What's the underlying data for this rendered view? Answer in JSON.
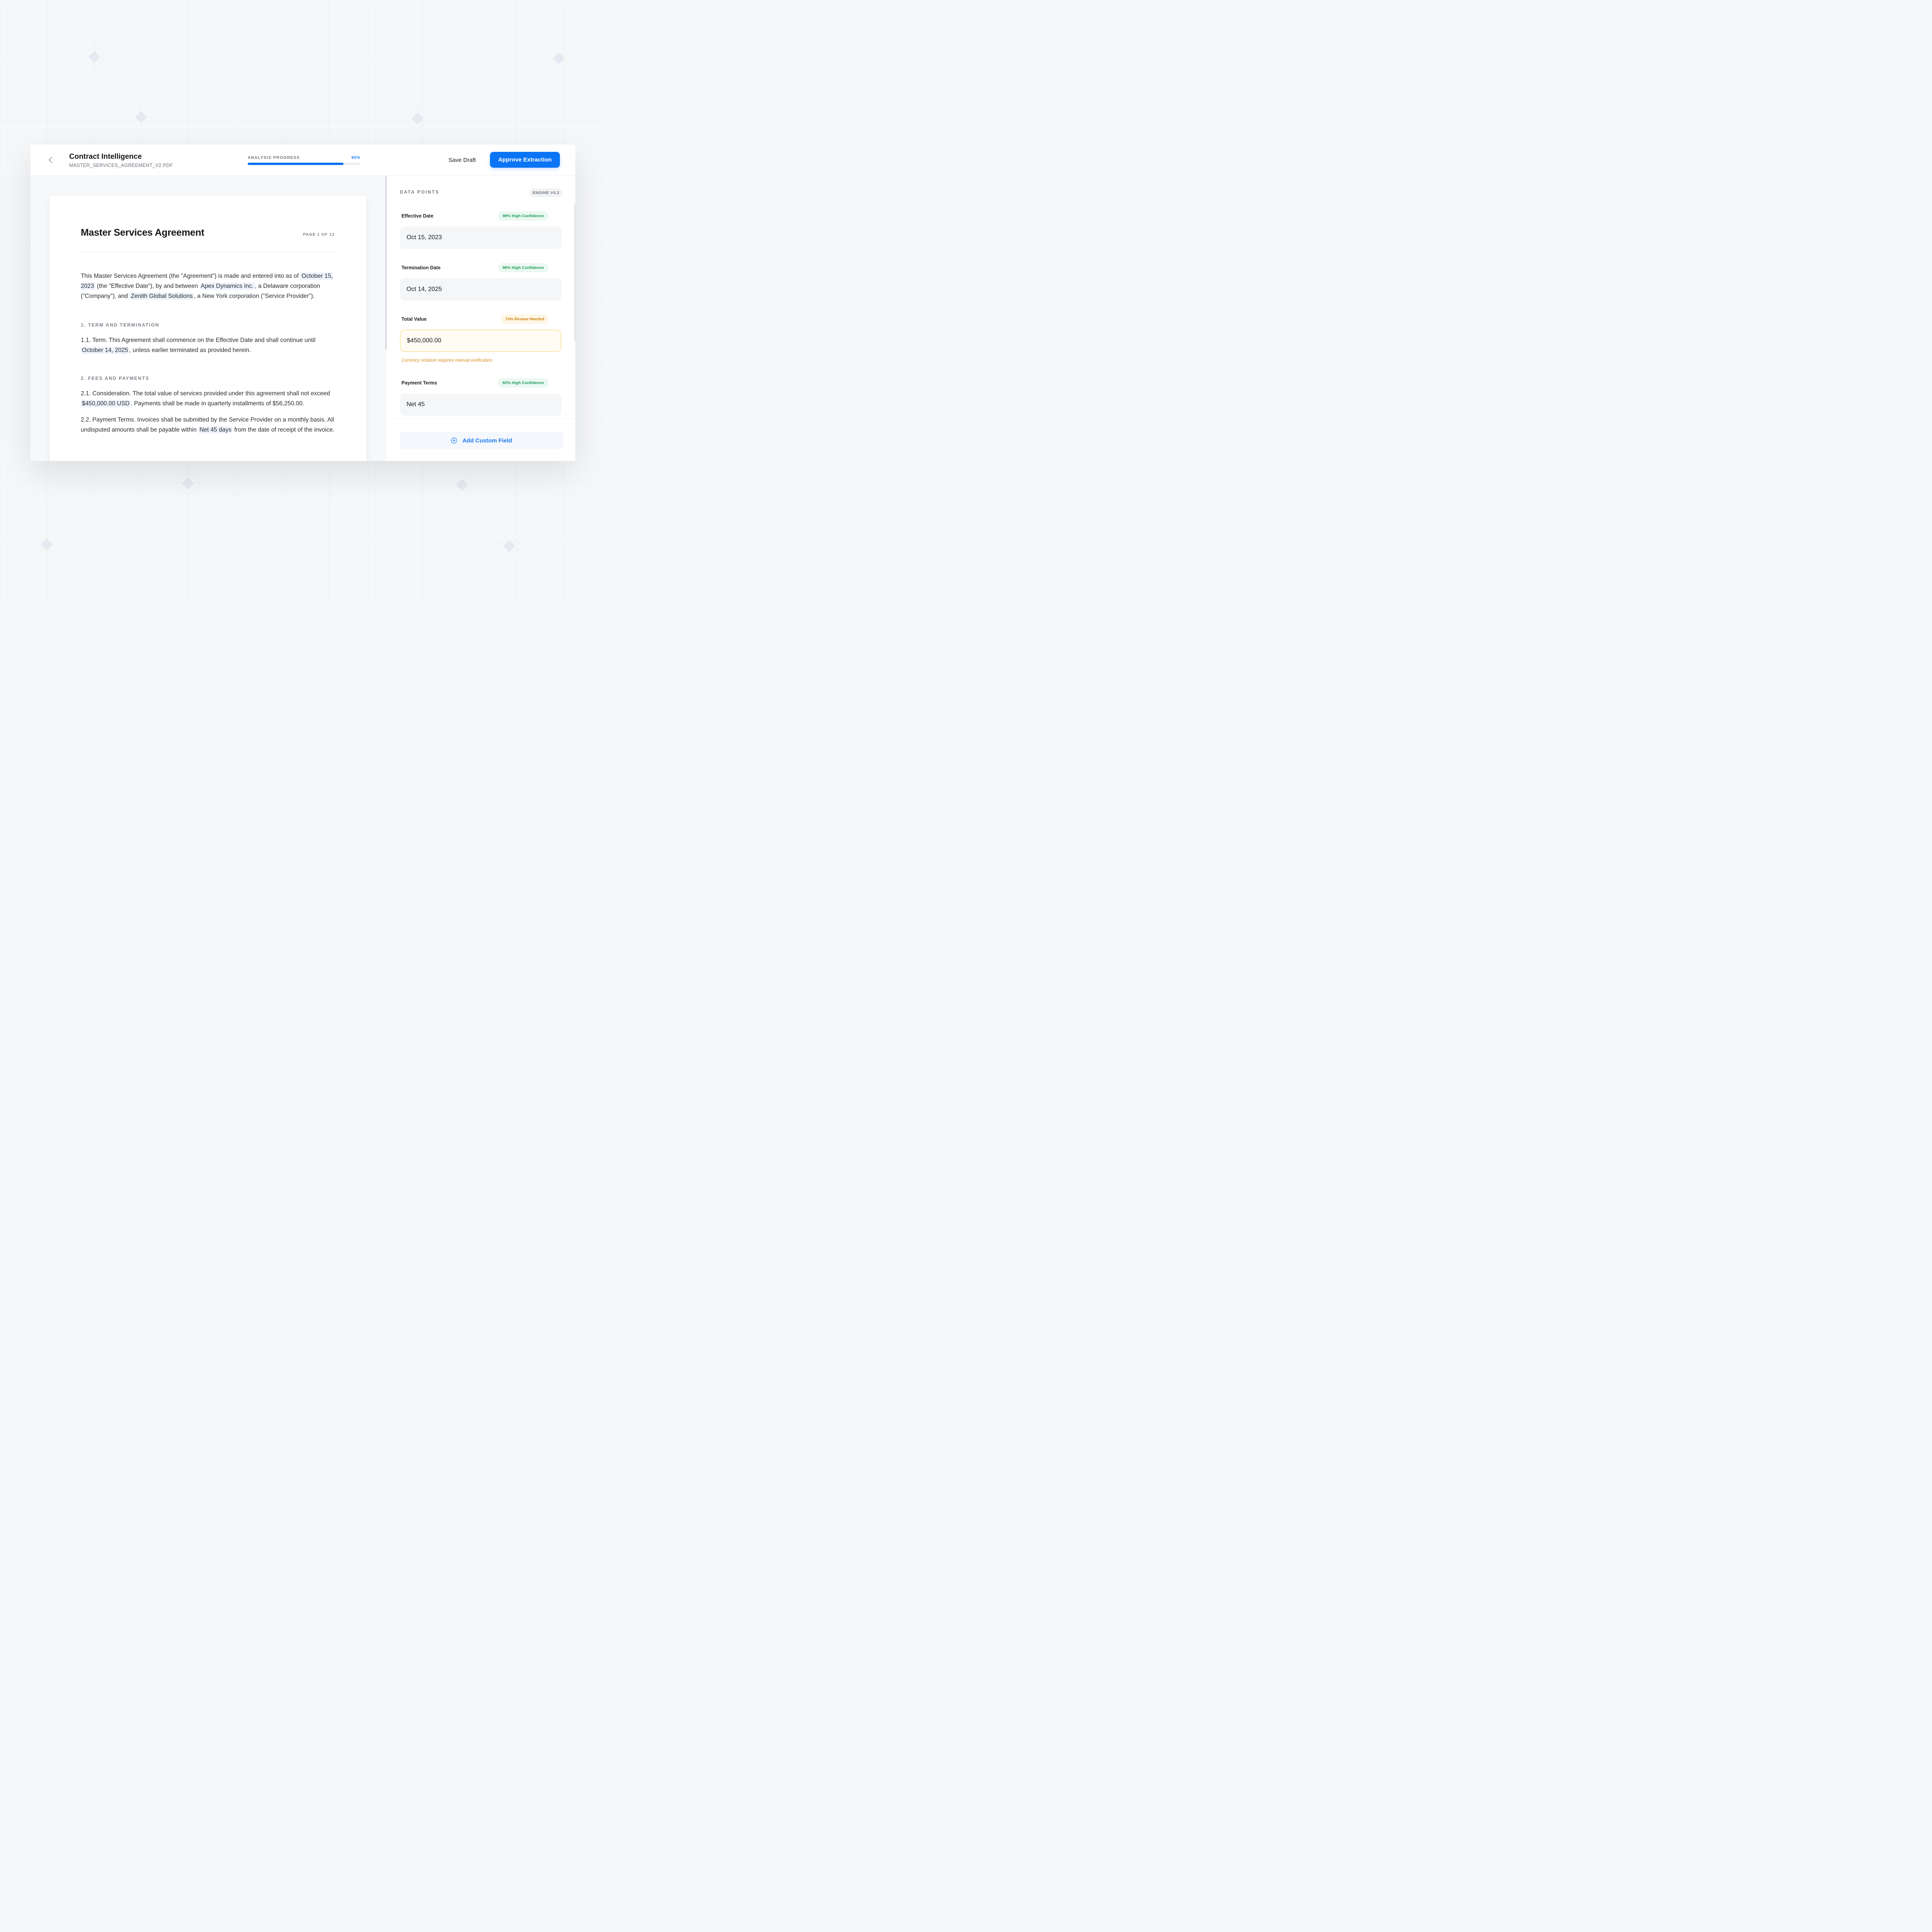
{
  "header": {
    "title": "Contract Intelligence",
    "filename": "MASTER_SERVICES_AGREEMENT_V2.PDF",
    "progress_label": "ANALYSIS PROGRESS",
    "progress_text": "85%",
    "progress_fraction": 0.85,
    "save_label": "Save Draft",
    "approve_label": "Approve Extraction"
  },
  "document": {
    "title": "Master Services Agreement",
    "page": "PAGE 1 OF 12",
    "intro": {
      "t1": "This Master Services Agreement (the \"Agreement\") is made and entered into as of ",
      "h1": "October 15, 2023",
      "t2": " (the \"Effective Date\"), by and between ",
      "h2": "Apex Dynamics Inc.",
      "t3": ", a Delaware corporation (\"Company\"), and ",
      "h3": "Zenith Global Solutions",
      "t4": ", a New York corporation (\"Service Provider\")."
    },
    "section1": {
      "heading": "1. TERM AND TERMINATION",
      "t1": "1.1. Term. This Agreement shall commence on the Effective Date and shall continue until ",
      "h1": "October 14, 2025",
      "t2": ", unless earlier terminated as provided herein."
    },
    "section2": {
      "heading": "2. FEES AND PAYMENTS",
      "p1_t1": "2.1. Consideration. The total value of services provided under this agreement shall not exceed ",
      "p1_h1": "$450,000.00 USD",
      "p1_t2": ". Payments shall be made in quarterly installments of $56,250.00.",
      "p2_t1": "2.2. Payment Terms. Invoices shall be submitted by the Service Provider on a monthly basis. All undisputed amounts shall be payable within ",
      "p2_h1": "Net 45 days",
      "p2_t2": " from the date of receipt of the invoice."
    }
  },
  "panel": {
    "label": "DATA POINTS",
    "engine": "ENGINE V4.2",
    "fields": [
      {
        "label": "Effective Date",
        "badge": "98% High Confidence",
        "status": "high",
        "value": "Oct 15, 2023"
      },
      {
        "label": "Termination Date",
        "badge": "96% High Confidence",
        "status": "high",
        "value": "Oct 14, 2025"
      },
      {
        "label": "Total Value",
        "badge": "74% Review Needed",
        "status": "review",
        "value": "$450,000.00",
        "note": "Currency notation requires manual verification."
      },
      {
        "label": "Payment Terms",
        "badge": "92% High Confidence",
        "status": "high",
        "value": "Net 45"
      }
    ],
    "add_field_label": "Add Custom Field"
  },
  "colors": {
    "accent": "#0a74f5",
    "success": "#1f9b5a",
    "warning": "#cd8214",
    "highlight": "#eef3fc"
  },
  "icons": {
    "back": "chevron-left-icon",
    "add": "plus-circle-icon"
  }
}
